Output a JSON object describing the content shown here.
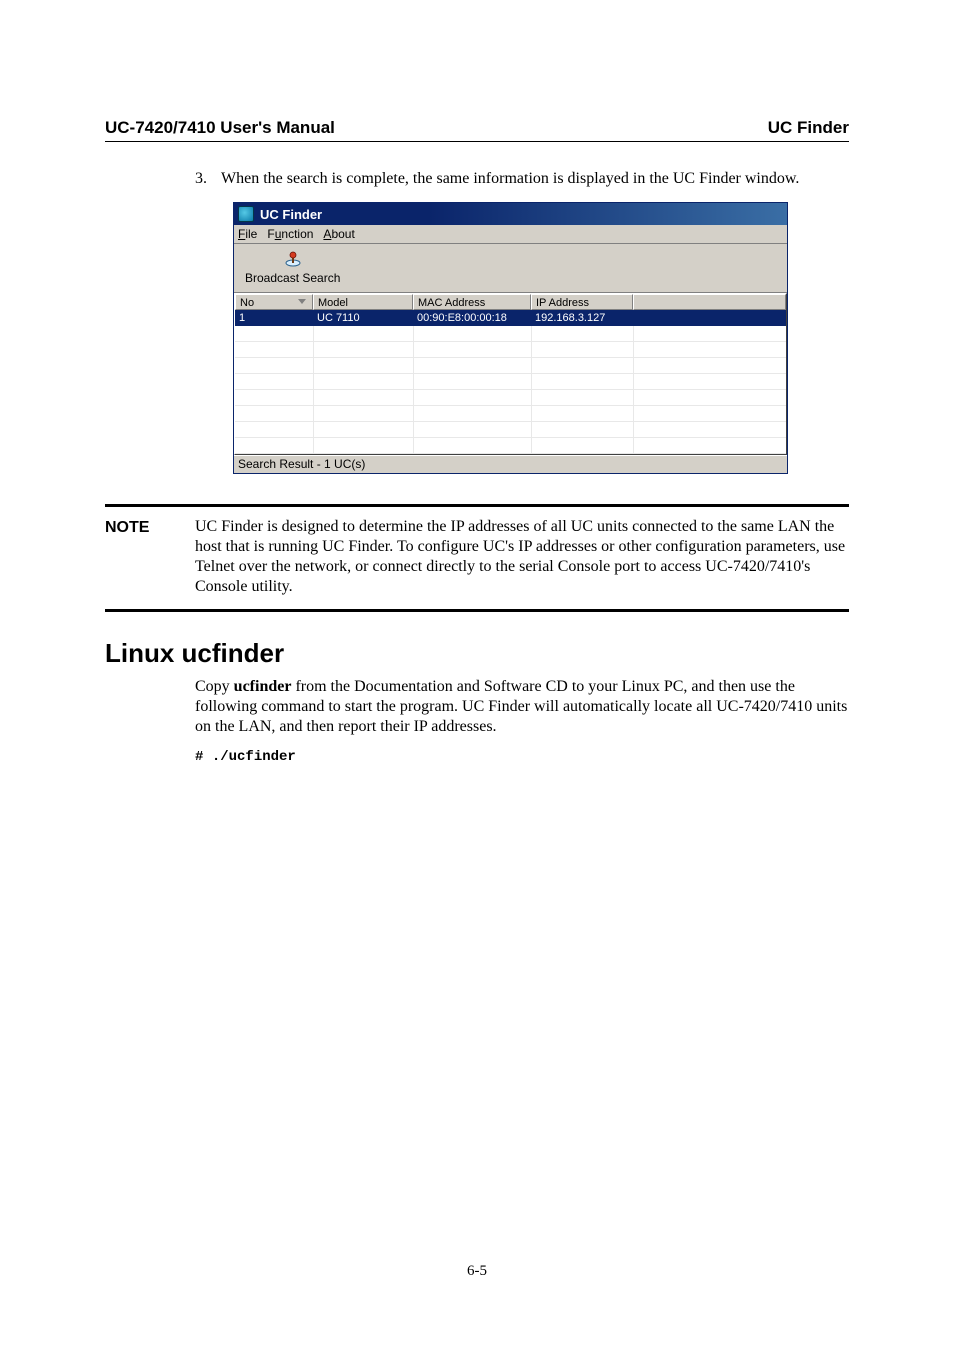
{
  "header": {
    "left": "UC-7420/7410 User's Manual",
    "right": "UC Finder"
  },
  "step": {
    "number": "3.",
    "text": "When the search is complete, the same information is displayed in the UC Finder window."
  },
  "window": {
    "title": "UC Finder",
    "menu": {
      "file_pre": "F",
      "file_rest": "ile",
      "func_pre": "F",
      "func_u": "u",
      "func_rest": "nction",
      "about_pre": "A",
      "about_rest": "bout"
    },
    "toolbar": {
      "broadcast_label": "Broadcast Search"
    },
    "columns": {
      "no": "No",
      "model": "Model",
      "mac": "MAC Address",
      "ip": "IP Address"
    },
    "row": {
      "no": "1",
      "model": "UC 7110",
      "mac": "00:90:E8:00:00:18",
      "ip": "192.168.3.127"
    },
    "status": "Search Result - 1 UC(s)"
  },
  "note": {
    "label": "NOTE",
    "text": "UC Finder is designed to determine the IP addresses of all UC units connected to the same LAN the host that is running UC Finder. To configure UC's IP addresses or other configuration parameters, use Telnet over the network, or connect directly to the serial Console port to access UC-7420/7410's Console utility."
  },
  "section": {
    "heading": "Linux ucfinder",
    "para_pre": "Copy ",
    "para_bold": "ucfinder",
    "para_post": " from the Documentation and Software CD to your Linux PC, and then use the following command to start the program. UC Finder will automatically locate all UC-7420/7410 units on the LAN, and then report their IP addresses.",
    "cmd": "./ucfinder"
  },
  "page_number": "6-5"
}
